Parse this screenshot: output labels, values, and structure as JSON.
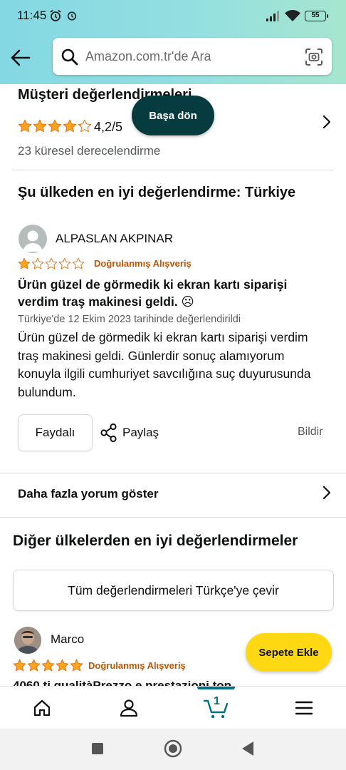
{
  "status_bar": {
    "time": "11:45",
    "battery": "55"
  },
  "search": {
    "placeholder": "Amazon.com.tr'de Ara"
  },
  "ratings": {
    "title": "Müşteri değerlendirmeleri",
    "average_text": "4,2/5",
    "average_value": 4.2,
    "global_count_text": "23 küresel derecelendirme"
  },
  "back_to_top_label": "Başa dön",
  "top_country_title": "Şu ülkeden en iyi değerlendirme: Türkiye",
  "review": {
    "author": "ALPASLAN AKPINAR",
    "stars": 1,
    "verified_label": "Doğrulanmış Alışveriş",
    "title": "Ürün güzel de görmedik ki ekran kartı siparişi verdim traş makinesi geldi. ☹",
    "date": "Türkiye'de 12 Ekim 2023 tarihinde değerlendirildi",
    "body": "Ürün güzel de görmedik ki ekran kartı siparişi verdim traş makinesi geldi. Günlerdir sonuç alamıyorum konuyla ilgili cumhuriyet savcılığına suç duyurusunda bulundum.",
    "helpful_label": "Faydalı",
    "share_label": "Paylaş",
    "report_label": "Bildir"
  },
  "more_reviews_label": "Daha fazla yorum göster",
  "other_countries": {
    "title": "Diğer ülkelerden en iyi değerlendirmeler",
    "translate_label": "Tüm değerlendirmeleri Türkçe'ye çevir",
    "review": {
      "author": "Marco",
      "stars": 5,
      "verified_label": "Doğrulanmış Alışveriş",
      "title_partial": "4060 ti qualitàPrezzo e prestazioni top"
    }
  },
  "add_to_cart_label": "Sepete Ekle",
  "bottom_nav": {
    "cart_count": "1"
  },
  "colors": {
    "star": "#ffa41c",
    "header_gradient_start": "#84d8e3",
    "back_to_top_bg": "#063c3f",
    "add_to_cart_bg": "#ffd814",
    "verified": "#c45500",
    "cart_accent": "#007185"
  }
}
